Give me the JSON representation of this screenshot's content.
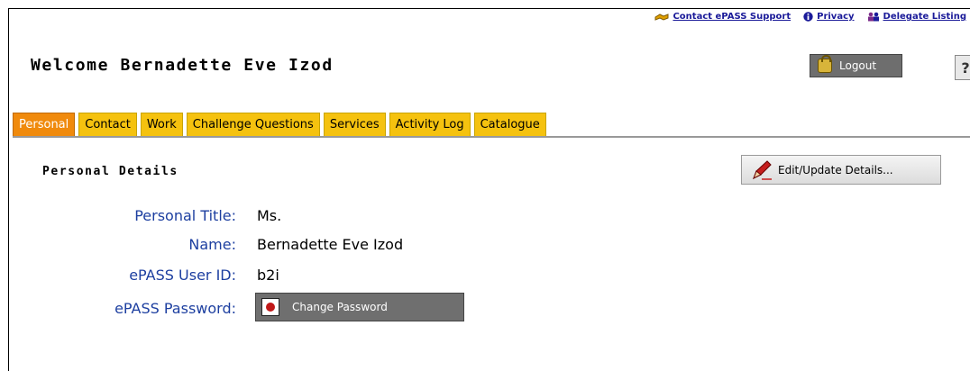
{
  "top_links": [
    {
      "label": "Contact ePASS Support",
      "icon": "handshake-icon"
    },
    {
      "label": "Privacy",
      "icon": "info-icon"
    },
    {
      "label": "Delegate Listing",
      "icon": "people-icon"
    }
  ],
  "header": {
    "welcome": "Welcome Bernadette Eve Izod",
    "logout_label": "Logout",
    "help_label": "?"
  },
  "tabs": [
    {
      "label": "Personal",
      "active": true
    },
    {
      "label": "Contact"
    },
    {
      "label": "Work"
    },
    {
      "label": "Challenge Questions"
    },
    {
      "label": "Services"
    },
    {
      "label": "Activity Log"
    },
    {
      "label": "Catalogue"
    }
  ],
  "section": {
    "title": "Personal Details",
    "edit_label": "Edit/Update Details..."
  },
  "details": {
    "title_label": "Personal Title:",
    "title_value": "Ms.",
    "name_label": "Name:",
    "name_value": "Bernadette Eve Izod",
    "userid_label": "ePASS User ID:",
    "userid_value": "b2i",
    "password_label": "ePASS Password:",
    "change_password_label": "Change Password"
  },
  "colors": {
    "tab": "#f5c20f",
    "tab_active": "#f08a0c",
    "label_blue": "#1d3fa0",
    "link_blue": "#1a1a99"
  }
}
